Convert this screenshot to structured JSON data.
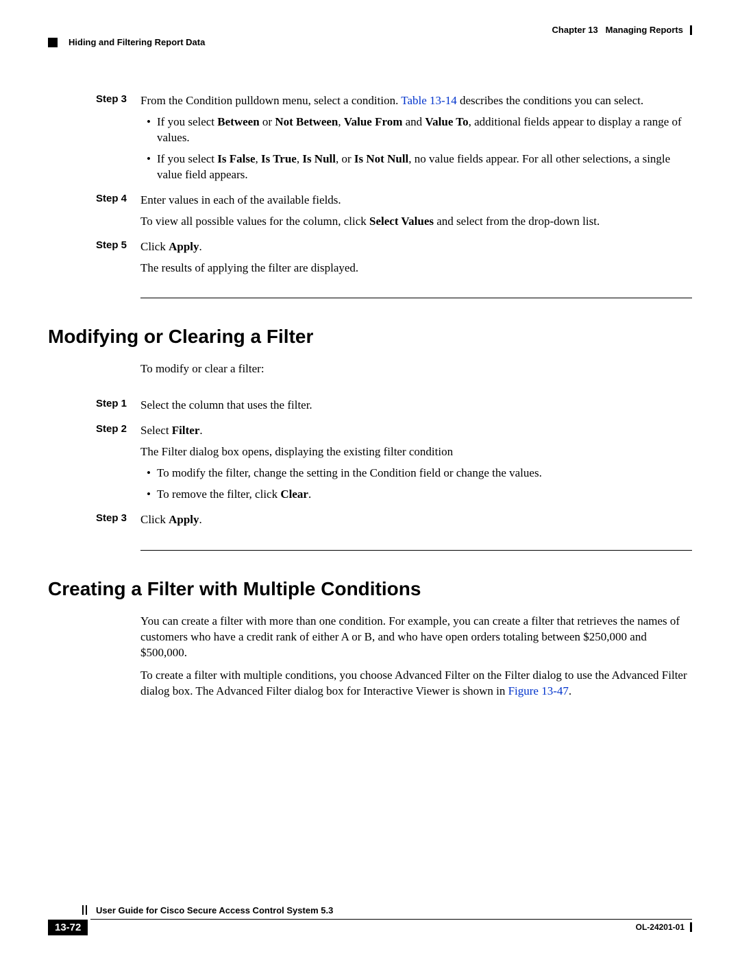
{
  "header": {
    "chapter": "Chapter 13",
    "chapter_title": "Managing Reports",
    "section": "Hiding and Filtering Report Data"
  },
  "steps_a": {
    "s3": {
      "label": "Step 3",
      "p1a": "From the Condition pulldown menu, select a condition. ",
      "link": "Table 13-14",
      "p1b": " describes the conditions you can select.",
      "b1a": "If you select ",
      "b1_between": "Between",
      "b1_or1": " or ",
      "b1_notbetween": "Not Between",
      "b1_comma": ", ",
      "b1_vfrom": "Value From",
      "b1_and": " and ",
      "b1_vto": "Value To",
      "b1b": ", additional fields appear to display a range of values.",
      "b2a": "If you select ",
      "b2_isfalse": "Is False",
      "b2_c1": ", ",
      "b2_istrue": "Is True",
      "b2_c2": ", ",
      "b2_isnull": "Is Null",
      "b2_c3": ", or ",
      "b2_isnotnull": "Is Not Null",
      "b2b": ", no value fields appear. For all other selections, a single value field appears."
    },
    "s4": {
      "label": "Step 4",
      "p1": "Enter values in each of the available fields.",
      "p2a": "To view all possible values for the column, click ",
      "p2_sv": "Select Values",
      "p2b": " and select from the drop-down list."
    },
    "s5": {
      "label": "Step 5",
      "p1a": "Click ",
      "p1_apply": "Apply",
      "p1b": ".",
      "p2": "The results of applying the filter are displayed."
    }
  },
  "heading_b": "Modifying or Clearing a Filter",
  "intro_b": "To modify or clear a filter:",
  "steps_b": {
    "s1": {
      "label": "Step 1",
      "p1": "Select the column that uses the filter."
    },
    "s2": {
      "label": "Step 2",
      "p1a": "Select ",
      "p1_filter": "Filter",
      "p1b": ".",
      "p2": "The Filter dialog box opens, displaying the existing filter condition",
      "b1": "To modify the filter, change the setting in the Condition field or change the values.",
      "b2a": "To remove the filter, click ",
      "b2_clear": "Clear",
      "b2b": "."
    },
    "s3": {
      "label": "Step 3",
      "p1a": "Click ",
      "p1_apply": "Apply",
      "p1b": "."
    }
  },
  "heading_c": "Creating a Filter with Multiple Conditions",
  "intro_c": {
    "p1": "You can create a filter with more than one condition. For example, you can create a filter that retrieves the names of customers who have a credit rank of either A or B, and who have open orders totaling between $250,000 and $500,000.",
    "p2a": "To create a filter with multiple conditions, you choose Advanced Filter on the Filter dialog to use the Advanced Filter dialog box. The Advanced Filter dialog box for Interactive Viewer is shown in ",
    "p2_link": "Figure 13-47",
    "p2b": "."
  },
  "footer": {
    "guide": "User Guide for Cisco Secure Access Control System 5.3",
    "page": "13-72",
    "docid": "OL-24201-01"
  }
}
